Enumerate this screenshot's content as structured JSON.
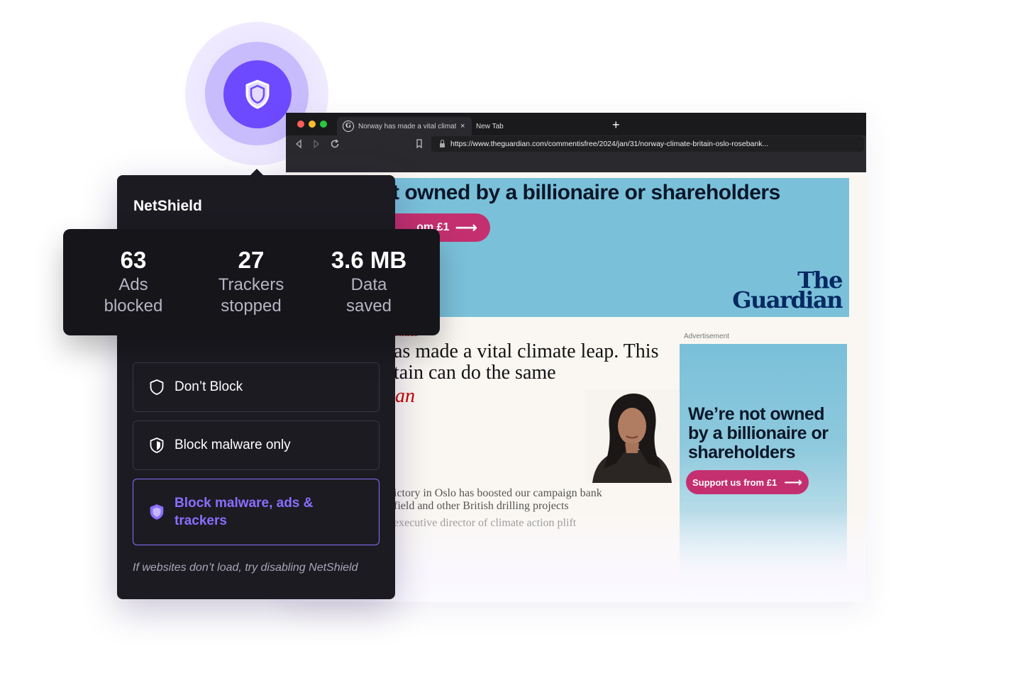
{
  "colors": {
    "accent": "#6d4aff",
    "accent_text": "#8a6eff",
    "panel_bg": "#1c1b22",
    "guardian_blue": "#7ac0d9",
    "guardian_pink": "#c4306f"
  },
  "browser": {
    "tabs": [
      {
        "label": "Norway has made a vital climate leap",
        "icon": "guardian-favicon"
      },
      {
        "label": "New Tab"
      }
    ],
    "close_glyph": "×",
    "new_tab_glyph": "+",
    "url": "https://www.theguardian.com/commentisfree/2024/jan/31/norway-climate-britain-oslo-rosebank..."
  },
  "guardian": {
    "banner_headline": "t owned by a billionaire or shareholders",
    "banner_button": "om £1",
    "arrow": "⟶",
    "logo_line1": "The",
    "logo_line2": "Guardian",
    "kicker": "olitics",
    "headline": "as made a vital climate leap. This tain can do the same",
    "byline": "an",
    "standfirst_1": "ictory in Oslo has boosted our campaign bank field and other British drilling projects",
    "standfirst_2": "executive director of climate action plift",
    "ad_label": "Advertisement",
    "ad_text": "We’re not owned by a billionaire or shareholders",
    "ad_button": "Support us from £1"
  },
  "netshield": {
    "title": "NetShield",
    "stats": [
      {
        "value": "63",
        "label": "Ads blocked"
      },
      {
        "value": "27",
        "label": "Trackers stopped"
      },
      {
        "value": "3.6 MB",
        "label": "Data saved"
      }
    ],
    "options": [
      {
        "label": "Don’t Block",
        "icon": "shield-outline-icon",
        "selected": false
      },
      {
        "label": "Block malware only",
        "icon": "shield-half-icon",
        "selected": false
      },
      {
        "label": "Block malware, ads & trackers",
        "icon": "shield-filled-icon",
        "selected": true
      }
    ],
    "hint": "If websites don’t load, try disabling NetShield"
  }
}
